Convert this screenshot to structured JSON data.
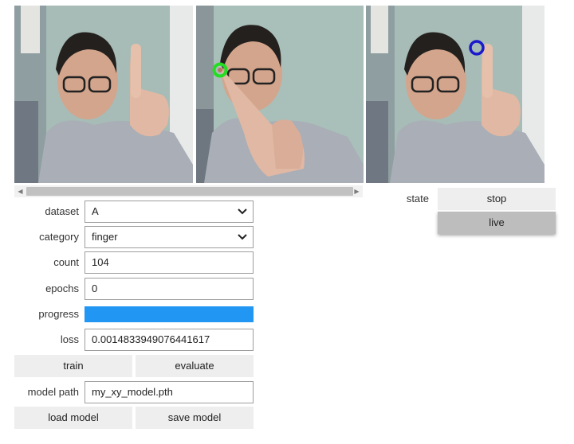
{
  "colors": {
    "accent": "#2196f3",
    "marker_green": "#22dd22",
    "marker_blue": "#1a1acc",
    "button_bg": "#eeeeee",
    "toggle_selected_bg": "#bdbdbd"
  },
  "form": {
    "dataset": {
      "label": "dataset",
      "value": "A"
    },
    "category": {
      "label": "category",
      "value": "finger"
    },
    "count": {
      "label": "count",
      "value": "104"
    },
    "epochs": {
      "label": "epochs",
      "value": "0"
    },
    "progress": {
      "label": "progress",
      "value": 1.0
    },
    "loss": {
      "label": "loss",
      "value": "0.0014833949076441617"
    },
    "model_path": {
      "label": "model path",
      "value": "my_xy_model.pth"
    }
  },
  "buttons": {
    "train": "train",
    "evaluate": "evaluate",
    "load_model": "load model",
    "save_model": "save model"
  },
  "state": {
    "label": "state",
    "options": [
      "stop",
      "live"
    ],
    "selected": "live"
  }
}
